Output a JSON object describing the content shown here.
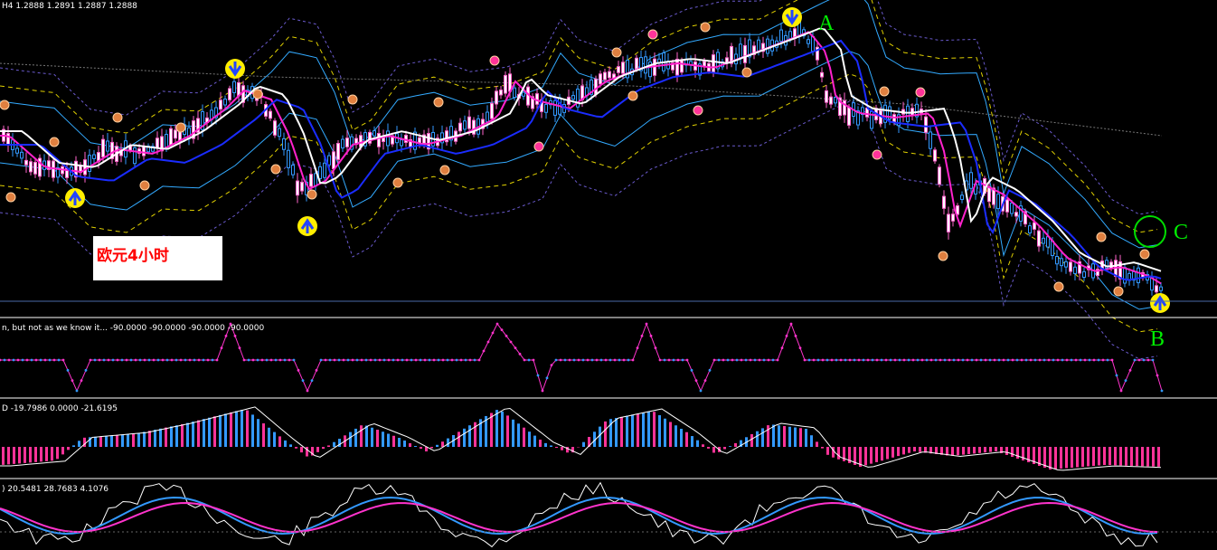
{
  "chart_data": [
    {
      "type": "candlestick",
      "header": "H4  1.2888  1.2891  1.2887  1.2888",
      "annotation": "欧元4小时",
      "markers": [
        "A",
        "B",
        "C"
      ],
      "colors": {
        "bull": "#3399ff",
        "bear": "#ff66cc",
        "ma_white": "#ffffff",
        "ma_magenta": "#ff22cc",
        "ma_blue": "#1a2cff",
        "band_yellow": "#e0d000",
        "band_purple": "#6a5acd",
        "band_cyan": "#33aaff"
      }
    },
    {
      "type": "line",
      "header": "n, but not as we know it...  -90.0000  -90.0000  -90.0000  -90.0000"
    },
    {
      "type": "bar",
      "header": "D  -19.7986  0.0000  -21.6195"
    },
    {
      "type": "line",
      "header": ")  20.5481  28.7683  4.1076"
    }
  ]
}
